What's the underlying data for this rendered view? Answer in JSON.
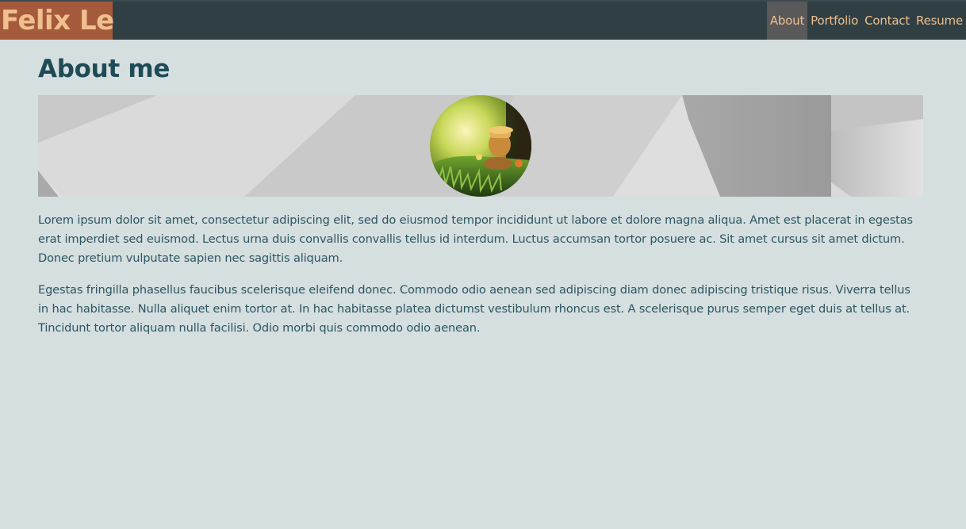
{
  "brand": {
    "name": "Felix Le"
  },
  "nav": {
    "items": [
      {
        "label": "About",
        "active": true
      },
      {
        "label": "Portfolio",
        "active": false
      },
      {
        "label": "Contact",
        "active": false
      },
      {
        "label": "Resume",
        "active": false
      }
    ]
  },
  "main": {
    "title": "About me",
    "paragraphs": [
      "Lorem ipsum dolor sit amet, consectetur adipiscing elit, sed do eiusmod tempor incididunt ut labore et dolore magna aliqua. Amet est placerat in egestas erat imperdiet sed euismod. Lectus urna duis convallis convallis tellus id interdum. Luctus accumsan tortor posuere ac. Sit amet cursus sit amet dictum. Donec pretium vulputate sapien nec sagittis aliquam.",
      "Egestas fringilla phasellus faucibus scelerisque eleifend donec. Commodo odio aenean sed adipiscing diam donec adipiscing tristique risus. Viverra tellus in hac habitasse. Nulla aliquet enim tortor at. In hac habitasse platea dictumst vestibulum rhoncus est. A scelerisque purus semper eget duis at tellus at. Tincidunt tortor aliquam nulla facilisi. Odio morbi quis commodo odio aenean."
    ]
  },
  "colors": {
    "nav_bg": "#2f3f44",
    "brand_bg": "#a55a3c",
    "brand_text": "#f0bf8e",
    "nav_text": "#eec08e",
    "nav_active_bg": "#59595a",
    "page_bg": "#d5dfe0",
    "heading": "#1f4b57",
    "body_text": "#2d5560"
  }
}
